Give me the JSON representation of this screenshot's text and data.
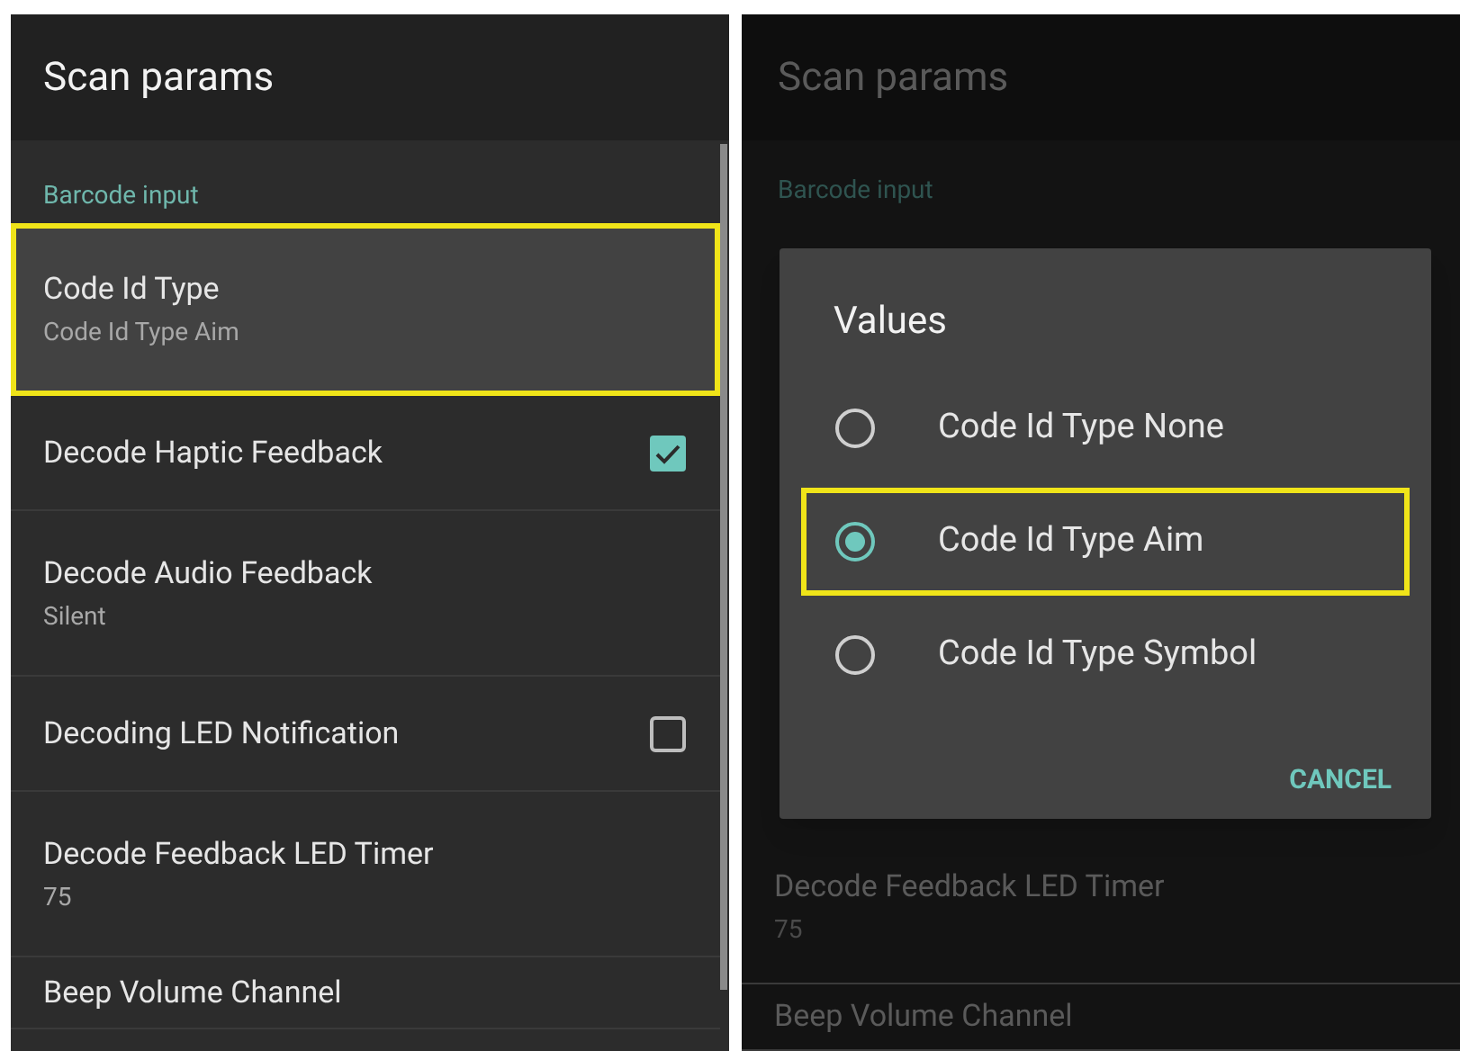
{
  "settings_screen": {
    "title": "Scan params",
    "section": "Barcode input",
    "items": [
      {
        "kind": "text",
        "title": "Code Id Type",
        "summary": "Code Id Type Aim",
        "highlighted": true
      },
      {
        "kind": "checkbox",
        "title": "Decode Haptic Feedback",
        "checked": true,
        "highlighted": false
      },
      {
        "kind": "text",
        "title": "Decode Audio Feedback",
        "summary": "Silent",
        "highlighted": false
      },
      {
        "kind": "checkbox",
        "title": "Decoding LED Notification",
        "checked": false,
        "highlighted": false
      },
      {
        "kind": "text",
        "title": "Decode Feedback LED Timer",
        "summary": "75",
        "highlighted": false
      },
      {
        "kind": "text",
        "title": "Beep Volume Channel",
        "highlighted": false
      }
    ]
  },
  "dialog_screen": {
    "title": "Scan params",
    "section": "Barcode input",
    "visible_items": [
      {
        "title": "Decode Feedback LED Timer",
        "summary": "75"
      },
      {
        "title": "Beep Volume Channel"
      }
    ],
    "dialog": {
      "title": "Values",
      "options": [
        {
          "label": "Code Id Type None",
          "selected": false,
          "highlighted": false
        },
        {
          "label": "Code Id Type Aim",
          "selected": true,
          "highlighted": true
        },
        {
          "label": "Code Id Type Symbol",
          "selected": false,
          "highlighted": false
        }
      ],
      "button": "CANCEL"
    }
  }
}
